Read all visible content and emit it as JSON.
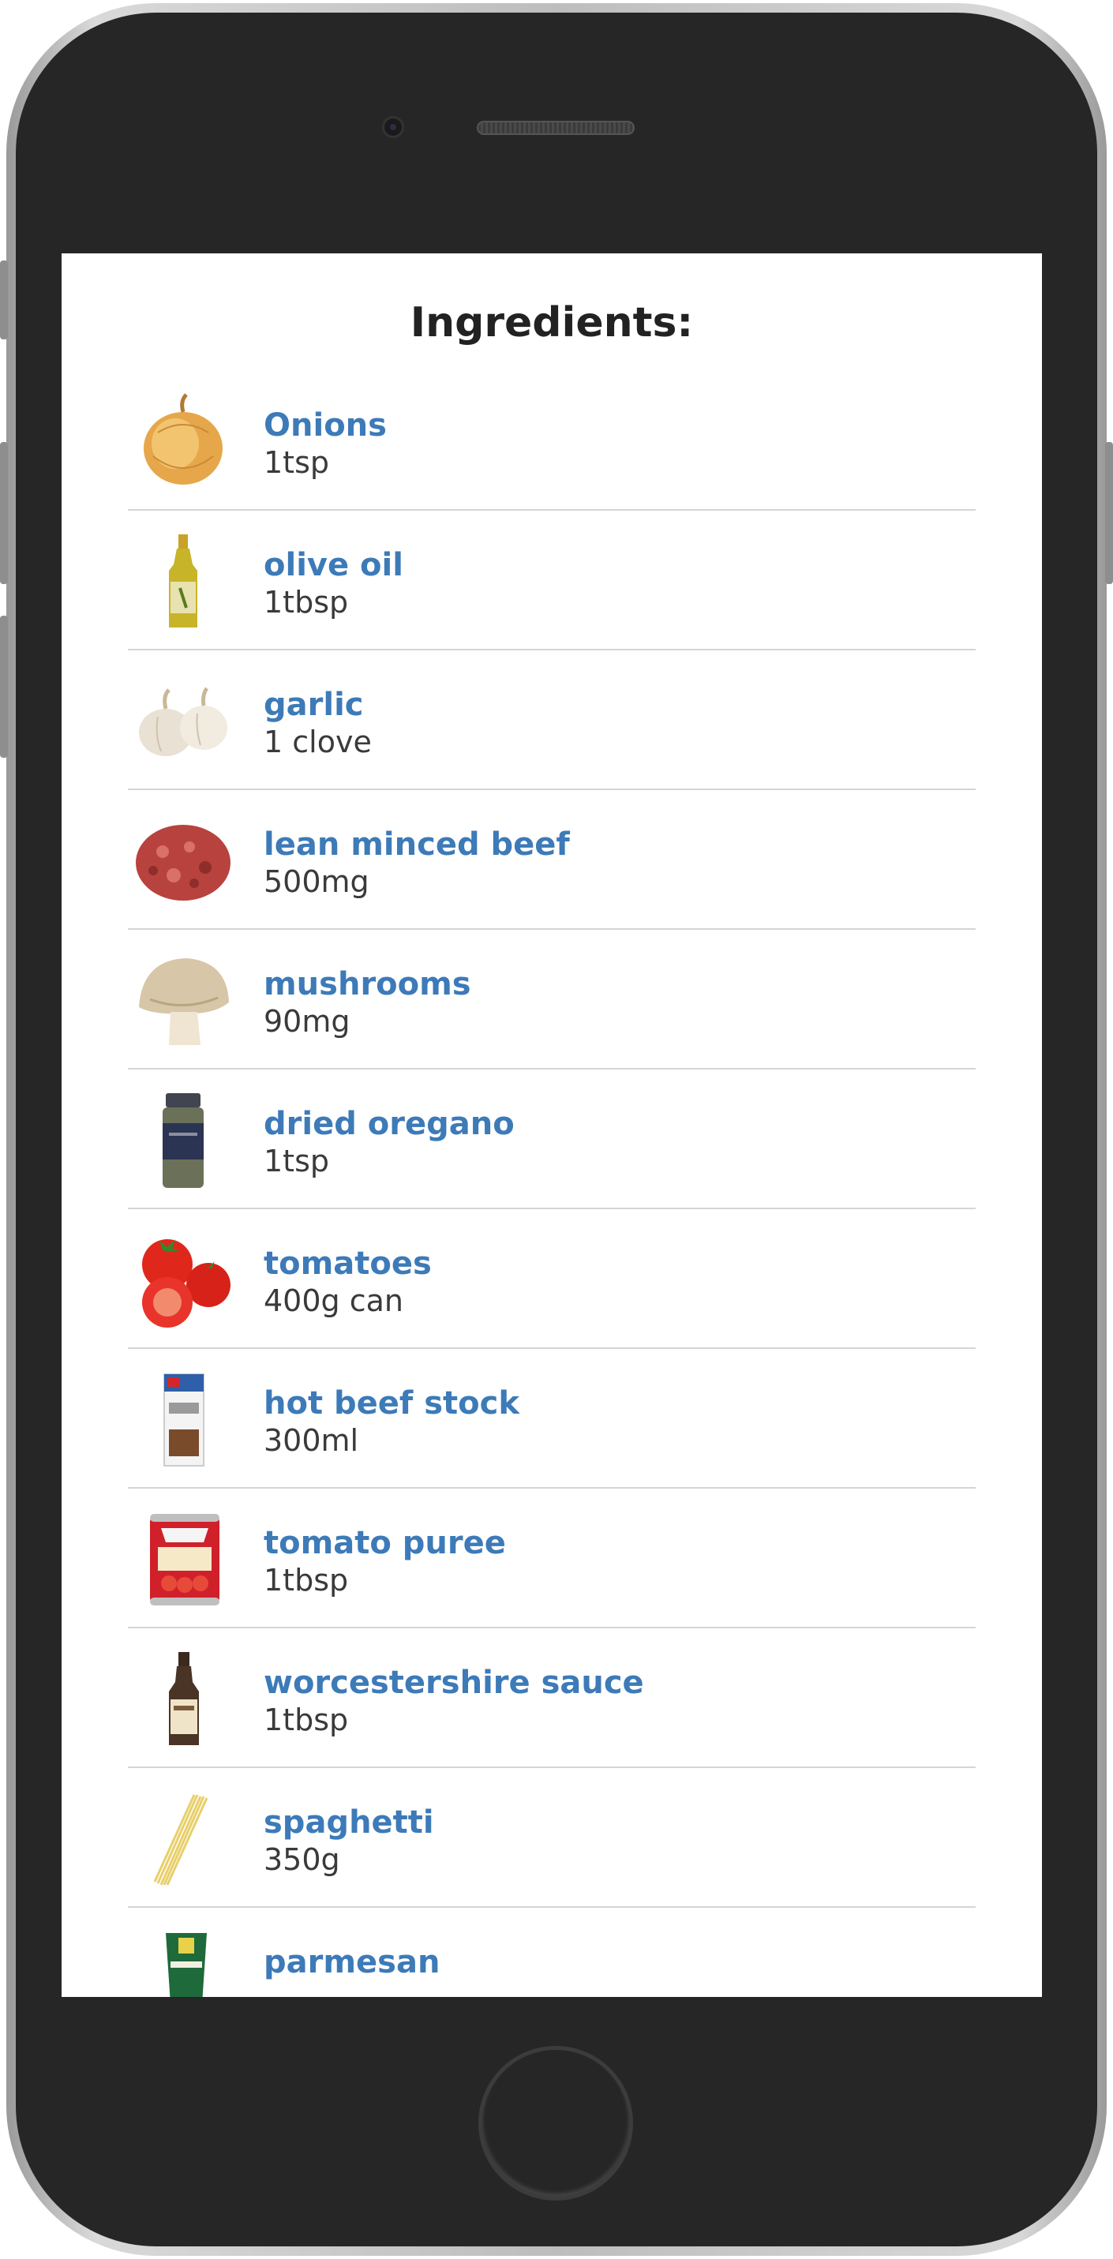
{
  "title": "Ingredients:",
  "ingredients": [
    {
      "name": "Onions",
      "qty": "1tsp",
      "icon": "onion-icon"
    },
    {
      "name": "olive oil",
      "qty": "1tbsp",
      "icon": "olive-oil-bottle-icon"
    },
    {
      "name": "garlic",
      "qty": "1 clove",
      "icon": "garlic-icon"
    },
    {
      "name": "lean minced beef",
      "qty": "500mg",
      "icon": "minced-beef-icon"
    },
    {
      "name": "mushrooms",
      "qty": "90mg",
      "icon": "mushroom-icon"
    },
    {
      "name": "dried oregano",
      "qty": "1tsp",
      "icon": "oregano-jar-icon"
    },
    {
      "name": "tomatoes",
      "qty": "400g can",
      "icon": "tomatoes-icon"
    },
    {
      "name": "hot beef stock",
      "qty": "300ml",
      "icon": "beef-stock-carton-icon"
    },
    {
      "name": "tomato puree",
      "qty": "1tbsp",
      "icon": "tomato-puree-can-icon"
    },
    {
      "name": "worcestershire sauce",
      "qty": "1tbsp",
      "icon": "sauce-bottle-icon"
    },
    {
      "name": "spaghetti",
      "qty": "350g",
      "icon": "spaghetti-icon"
    },
    {
      "name": "parmesan",
      "qty": "",
      "icon": "parmesan-icon"
    }
  ]
}
